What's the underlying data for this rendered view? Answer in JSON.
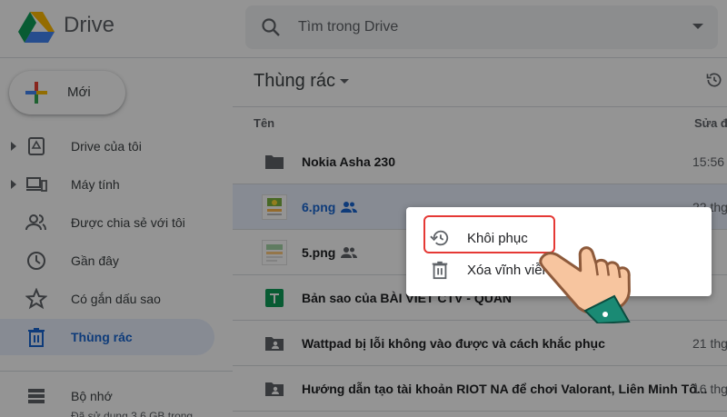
{
  "app": {
    "brand": "Drive"
  },
  "search": {
    "placeholder": "Tìm trong Drive"
  },
  "sidebar": {
    "new_label": "Mới",
    "items": [
      {
        "label": "Drive của tôi"
      },
      {
        "label": "Máy tính"
      },
      {
        "label": "Được chia sẻ với tôi"
      },
      {
        "label": "Gần đây"
      },
      {
        "label": "Có gắn dấu sao"
      },
      {
        "label": "Thùng rác"
      }
    ],
    "storage": {
      "label": "Bộ nhớ",
      "usage": "Đã sử dụng 3,6 GB trong"
    }
  },
  "main": {
    "title": "Thùng rác",
    "columns": {
      "name": "Tên",
      "modified": "Sửa đ"
    },
    "rows": [
      {
        "name": "Nokia Asha 230",
        "date": "15:56",
        "icon": "folder-icon"
      },
      {
        "name": "6.png",
        "date": "22 thg",
        "icon": "image-thumbnail",
        "shared": true
      },
      {
        "name": "5.png",
        "date": "",
        "icon": "image-thumbnail",
        "shared": true
      },
      {
        "name": "Bản sao của BÀI VIẾT CTV - QUÂN",
        "date": "",
        "icon": "sheets-icon"
      },
      {
        "name": "Wattpad bị lỗi không vào được và cách khắc phục",
        "date": "21 thg",
        "icon": "shared-folder-icon"
      },
      {
        "name": "Hướng dẫn tạo tài khoản RIOT NA để chơi Valorant, Liên Minh Tố...",
        "date": "16 thg",
        "icon": "shared-folder-icon"
      }
    ]
  },
  "context_menu": {
    "restore_label": "Khôi phục",
    "delete_label": "Xóa vĩnh viễn"
  },
  "colors": {
    "accent": "#1967d2",
    "highlight": "#e53935",
    "selected_bg": "#e8f0fe"
  }
}
